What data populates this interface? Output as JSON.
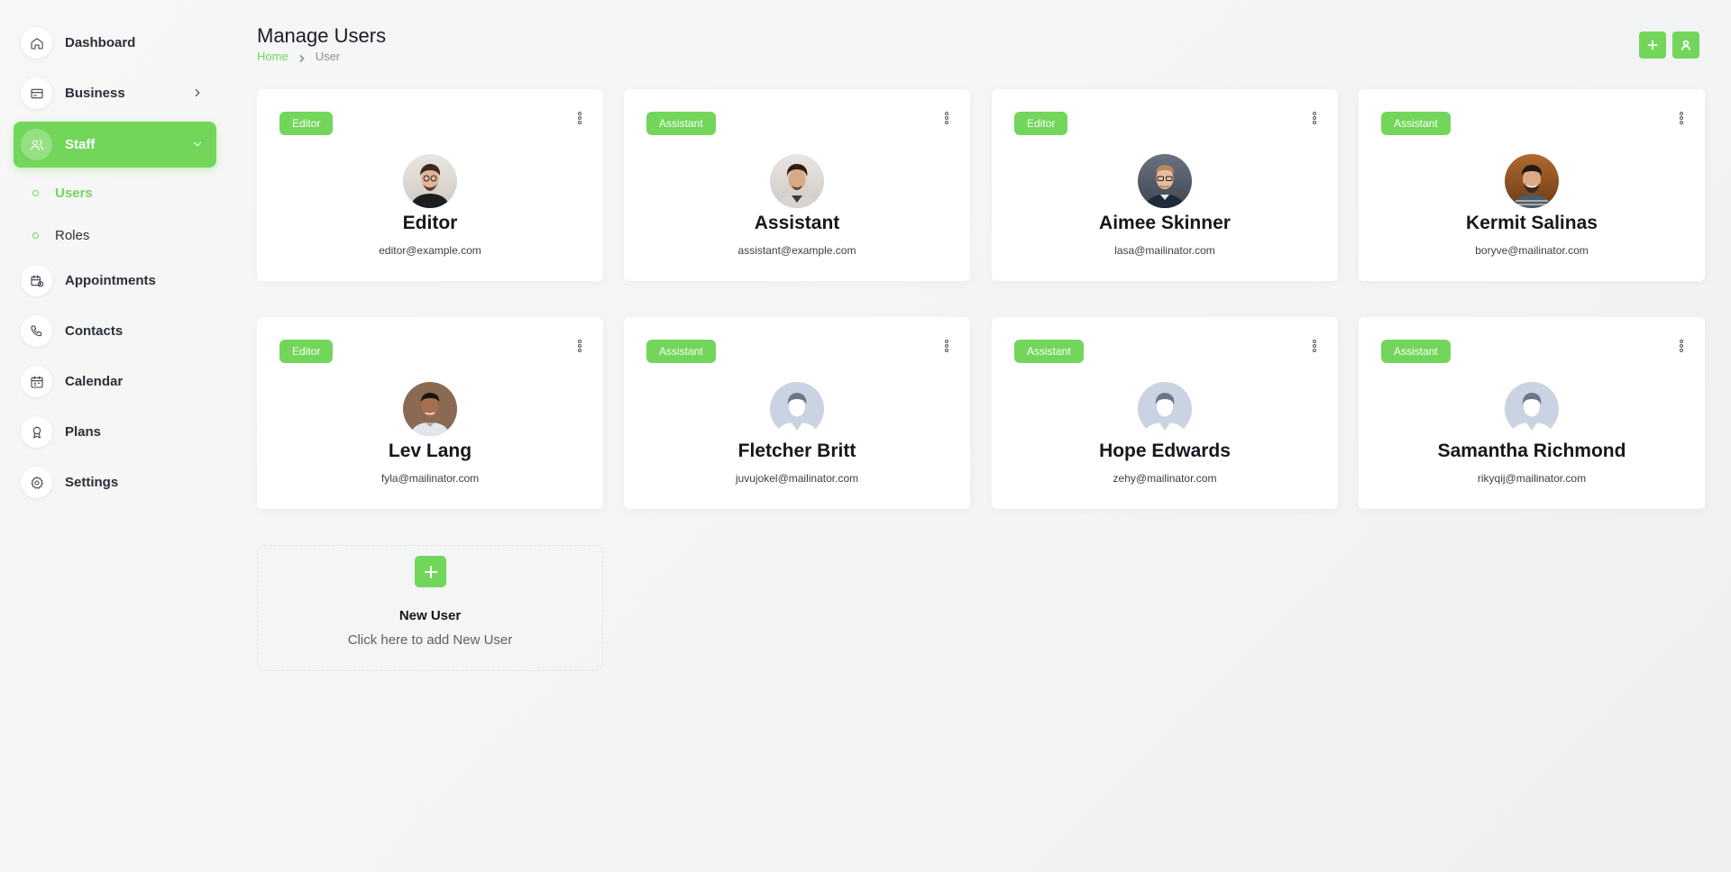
{
  "sidebar": {
    "items": [
      {
        "label": "Dashboard",
        "icon": "home-icon"
      },
      {
        "label": "Business",
        "icon": "wallet-icon"
      },
      {
        "label": "Staff",
        "icon": "users-icon"
      },
      {
        "label": "Appointments",
        "icon": "calendar-clock-icon"
      },
      {
        "label": "Contacts",
        "icon": "phone-icon"
      },
      {
        "label": "Calendar",
        "icon": "calendar-icon"
      },
      {
        "label": "Plans",
        "icon": "award-icon"
      },
      {
        "label": "Settings",
        "icon": "gear-icon"
      }
    ],
    "staff_sub": [
      {
        "label": "Users"
      },
      {
        "label": "Roles"
      }
    ],
    "active_item": "Staff",
    "active_sub": "Users"
  },
  "header": {
    "title": "Manage Users",
    "breadcrumb": {
      "home": "Home",
      "current": "User"
    },
    "actions": [
      {
        "icon": "plus-icon"
      },
      {
        "icon": "user-icon"
      }
    ]
  },
  "users": [
    {
      "role": "Editor",
      "name": "Editor",
      "email": "editor@example.com",
      "avatar": "photo"
    },
    {
      "role": "Assistant",
      "name": "Assistant",
      "email": "assistant@example.com",
      "avatar": "photo"
    },
    {
      "role": "Editor",
      "name": "Aimee Skinner",
      "email": "lasa@mailinator.com",
      "avatar": "photo"
    },
    {
      "role": "Assistant",
      "name": "Kermit Salinas",
      "email": "boryve@mailinator.com",
      "avatar": "photo"
    },
    {
      "role": "Editor",
      "name": "Lev Lang",
      "email": "fyla@mailinator.com",
      "avatar": "photo"
    },
    {
      "role": "Assistant",
      "name": "Fletcher Britt",
      "email": "juvujokel@mailinator.com",
      "avatar": "placeholder"
    },
    {
      "role": "Assistant",
      "name": "Hope Edwards",
      "email": "zehy@mailinator.com",
      "avatar": "placeholder"
    },
    {
      "role": "Assistant",
      "name": "Samantha Richmond",
      "email": "rikyqij@mailinator.com",
      "avatar": "placeholder"
    }
  ],
  "new_user": {
    "title": "New User",
    "subtitle": "Click here to add New User"
  },
  "colors": {
    "accent": "#72d65a",
    "background": "#f4f5f5",
    "card": "#ffffff"
  }
}
